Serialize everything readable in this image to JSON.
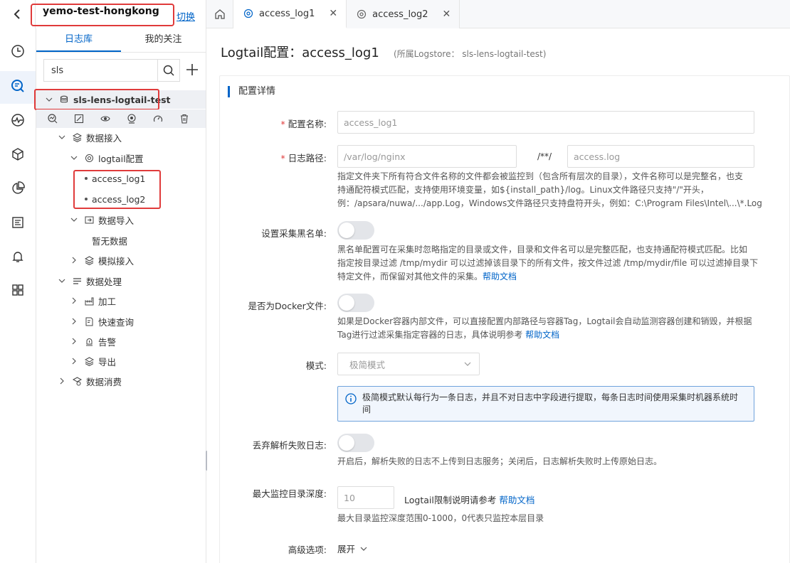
{
  "topbar": {
    "project_name": "yemo-test-hongkong",
    "switch_label": "切换",
    "tabs": [
      {
        "label": "access_log1",
        "active": true
      },
      {
        "label": "access_log2",
        "active": false
      }
    ]
  },
  "rail": {
    "icons": [
      "clock-icon",
      "search-log-icon",
      "monitor-icon",
      "cube-icon",
      "pie-chart-icon",
      "report-icon",
      "bell-icon",
      "grid-icon"
    ]
  },
  "sidebar": {
    "tabs": [
      "日志库",
      "我的关注"
    ],
    "search_value": "sls",
    "tree": {
      "logstore": "sls-lens-logtail-test",
      "data_access": "数据接入",
      "logtail_config": "logtail配置",
      "configs": [
        "access_log1",
        "access_log2"
      ],
      "data_import": "数据导入",
      "no_data": "暂无数据",
      "simulated_access": "模拟接入",
      "data_processing": "数据处理",
      "processing_items": [
        "加工",
        "快速查询",
        "告警",
        "导出"
      ],
      "data_consumption": "数据消费"
    }
  },
  "main": {
    "title": "Logtail配置：access_log1",
    "subtitle": "(所属Logstore：  sls-lens-logtail-test)",
    "section_title": "配置详情",
    "config_name": {
      "label": "配置名称:",
      "value": "access_log1"
    },
    "log_path": {
      "label": "日志路径:",
      "dir": "/var/log/nginx",
      "separator": "/**/",
      "file": "access.log",
      "help": [
        "指定文件夹下所有符合文件名称的文件都会被监控到（包含所有层次的目录），文件名称可以是完整名，也支",
        "持通配符模式匹配，支持使用环境变量，如${install_path}/log。Linux文件路径只支持\"/\"开头，",
        "例：/apsara/nuwa/.../app.Log，Windows文件路径只支持盘符开头，例如：C:\\Program Files\\Intel\\...\\*.Log"
      ]
    },
    "blacklist": {
      "label": "设置采集黑名单:",
      "help": [
        "黑名单配置可在采集时忽略指定的目录或文件，目录和文件名可以是完整匹配，也支持通配符模式匹配。比如",
        "指定按目录过滤 /tmp/mydir 可以过滤掉该目录下的所有文件，按文件过滤 /tmp/mydir/file 可以过滤掉目录下",
        "特定文件，而保留对其他文件的采集。"
      ],
      "help_link": "帮助文档"
    },
    "docker": {
      "label": "是否为Docker文件:",
      "help": [
        "如果是Docker容器内部文件，可以直接配置内部路径与容器Tag，Logtail会自动监测容器创建和销毁，并根据",
        "Tag进行过滤采集指定容器的日志，具体说明参考 "
      ],
      "help_link": "帮助文档"
    },
    "mode": {
      "label": "模式:",
      "value": "极简模式",
      "info": "极简模式默认每行为一条日志，并且不对日志中字段进行提取，每条日志时间使用采集时机器系统时间"
    },
    "discard": {
      "label": "丢弃解析失败日志:",
      "help": "开启后，解析失败的日志不上传到日志服务；关闭后，日志解析失败时上传原始日志。"
    },
    "max_depth": {
      "label": "最大监控目录深度:",
      "value": "10",
      "note": "Logtail限制说明请参考",
      "note_link": "帮助文档",
      "help": "最大目录监控深度范围0-1000，0代表只监控本层目录"
    },
    "advanced": {
      "label": "高级选项:",
      "expand": "展开"
    }
  }
}
